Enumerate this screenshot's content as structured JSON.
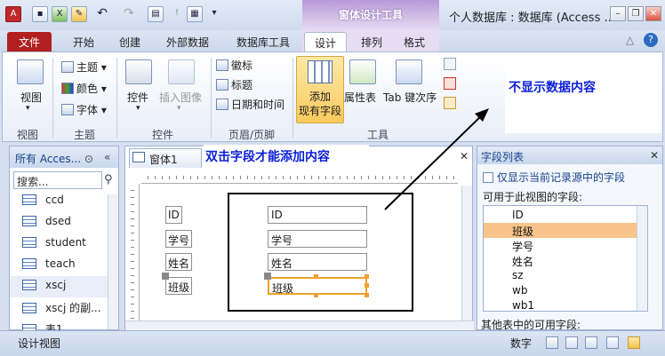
{
  "titlebar": {
    "context_tab_header": "窗体设计工具",
    "window_title": "个人数据库 : 数据库 (Access ..."
  },
  "tabs": [
    "文件",
    "开始",
    "创建",
    "外部数据",
    "数据库工具",
    "设计",
    "排列",
    "格式"
  ],
  "ribbon": {
    "view": {
      "label": "视图",
      "group": "视图"
    },
    "theme_items": [
      "主题",
      "颜色",
      "字体"
    ],
    "theme_group": "主题",
    "controls_label": "控件",
    "insert_image_label": "插入图像",
    "controls_group": "控件",
    "header_items": [
      "徽标",
      "标题",
      "日期和时间"
    ],
    "header_group": "页眉/页脚",
    "add_field_line1": "添加",
    "add_field_line2": "现有字段",
    "property_sheet": "属性表",
    "tab_order": "Tab 键次序",
    "tools_group": "工具"
  },
  "annotations": {
    "ribbon_note": "不显示数据内容",
    "form_note": "双击字段才能添加内容"
  },
  "nav": {
    "header": "所有 Acces...",
    "search_placeholder": "搜索...",
    "items": [
      "ccd",
      "dsed",
      "student",
      "teach",
      "xscj",
      "xscj 的副...",
      "表1"
    ]
  },
  "form": {
    "tab_title": "窗体1",
    "labels": [
      "ID",
      "学号",
      "姓名",
      "班级"
    ],
    "textboxes": [
      "ID",
      "学号",
      "姓名",
      "班级"
    ]
  },
  "field_list": {
    "title": "字段列表",
    "show_only_current": "仅显示当前记录源中的字段",
    "available_label": "可用于此视图的字段:",
    "fields": [
      "ID",
      "班级",
      "学号",
      "姓名",
      "sz",
      "wb",
      "wb1"
    ],
    "selected_index": 1,
    "other_tables_label": "其他表中的可用字段:"
  },
  "status": {
    "left": "设计视图",
    "mode": "数字"
  },
  "colors": {
    "file_tab": "#b1201e",
    "annotation": "#0a1fd8",
    "context_tab": "#b79ad8",
    "selected_field": "#f8c48a"
  }
}
